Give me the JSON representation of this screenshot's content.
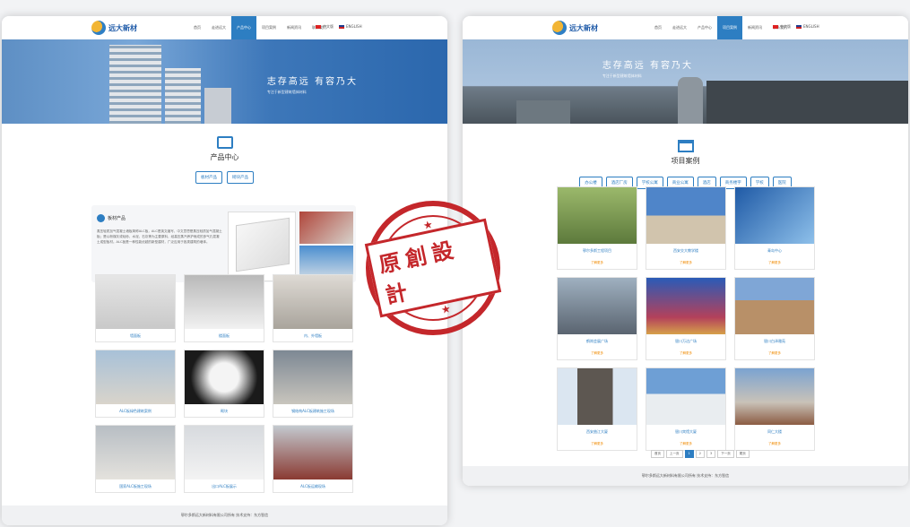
{
  "logo": {
    "name": "远大新材"
  },
  "nav": {
    "items": [
      "首页",
      "走进远大",
      "产品中心",
      "项目案例",
      "新闻资讯",
      "联系我们"
    ],
    "lang_cn": "中文版",
    "lang_en": "ENGLISH"
  },
  "banner": {
    "slogan": "志存高远 有容乃大",
    "sub": "专注于新型建筑墙体材料"
  },
  "left": {
    "section_title": "产品中心",
    "tabs": [
      "板材产品",
      "砌块产品"
    ],
    "featured": {
      "title": "板材产品",
      "text": "蒸压轻质加气混凝土墙板简称ALC板，ALC是英文缩写，中文意思是蒸压轻质加气混凝土板；是以粉煤灰或硅砂、水泥、石灰等为主要原料，经高压蒸汽养护而成的多气孔混凝土成型板材。ALC板是一种性能优越的新型建材，广泛应用于各类建筑的墙体。"
    },
    "products": [
      "墙面板",
      "楼面板",
      "内、外墙板",
      "ALC板绿色建筑案例",
      "砌块",
      "钢结构ALC板建筑施工现场",
      "国家ALC板施工现场",
      "出口ALC板展示",
      "ALC板运输现场"
    ],
    "footer": "鄂尔多斯远大新材料有限公司所有  技术支持：东方智信"
  },
  "right": {
    "section_title": "项目案例",
    "tabs": [
      "办公楼",
      "酒店厂房",
      "学校公寓",
      "商业公寓",
      "酒店",
      "商务楼宇",
      "学校",
      "医院"
    ],
    "cases": [
      "鄂尔多斯工程项目",
      "西安交大教学楼",
      "青岛中心",
      "鹤岗会展广场",
      "银川万达广场",
      "银川白泽雅苑",
      "西安曲江大厦",
      "银川宾馆大厦",
      "同仁大楼"
    ],
    "more_label": "了解更多",
    "pager": [
      "首页",
      "上一页",
      "1",
      "2",
      "3",
      "下一页",
      "尾页"
    ],
    "footer": "鄂尔多斯远大新材料有限公司所有  技术支持：东方智信"
  },
  "stamp": {
    "text": "原創設計"
  }
}
